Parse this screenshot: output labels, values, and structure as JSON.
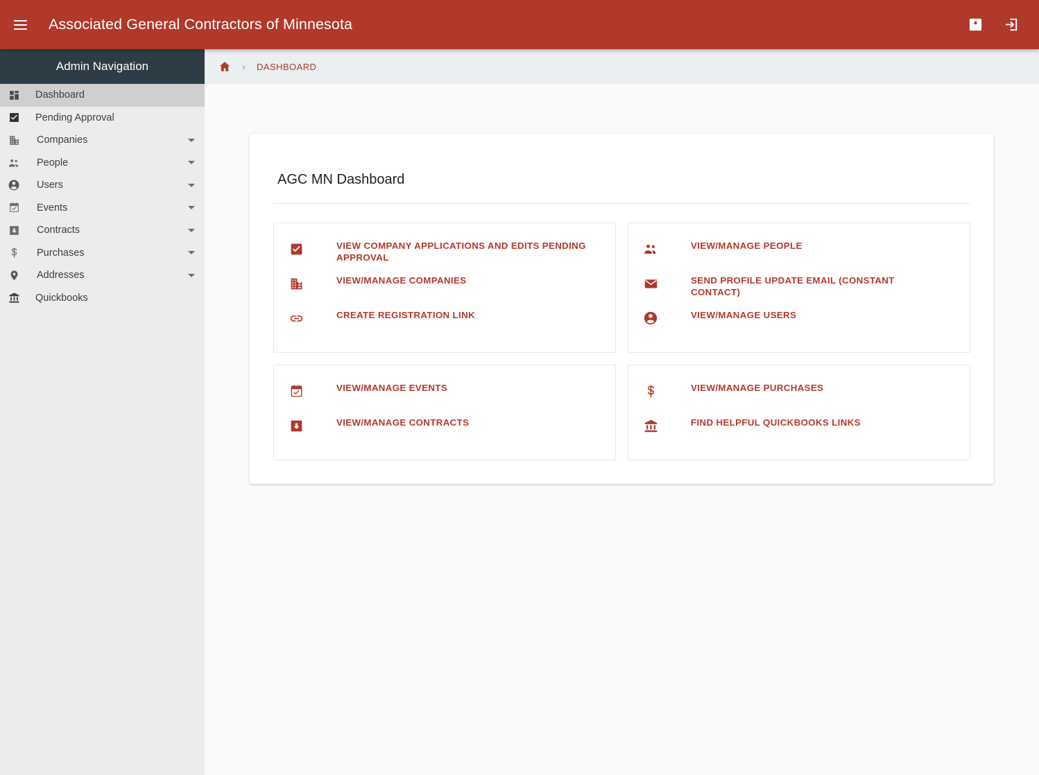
{
  "header": {
    "title": "Associated General Contractors of Minnesota",
    "menu_icon": "hamburger-menu-icon",
    "background_color": "#b0392c",
    "actions": [
      {
        "name": "account-box-icon",
        "label": "Account"
      },
      {
        "name": "logout-icon",
        "label": "Log out"
      }
    ]
  },
  "sidebar": {
    "title": "Admin Navigation",
    "background_color": "#ececec",
    "header_color": "#2e3d45",
    "items": [
      {
        "label": "Dashboard",
        "icon": "dashboard-icon",
        "active": true,
        "expandable": false
      },
      {
        "label": "Pending Approval",
        "icon": "check-box-icon",
        "active": false,
        "expandable": false
      },
      {
        "label": "Companies",
        "icon": "building-icon",
        "active": false,
        "expandable": true
      },
      {
        "label": "People",
        "icon": "people-icon",
        "active": false,
        "expandable": true
      },
      {
        "label": "Users",
        "icon": "account-circle-icon",
        "active": false,
        "expandable": true
      },
      {
        "label": "Events",
        "icon": "event-calendar-icon",
        "active": false,
        "expandable": true
      },
      {
        "label": "Contracts",
        "icon": "contract-box-icon",
        "active": false,
        "expandable": true
      },
      {
        "label": "Purchases",
        "icon": "dollar-sign-icon",
        "active": false,
        "expandable": true
      },
      {
        "label": "Addresses",
        "icon": "location-pin-icon",
        "active": false,
        "expandable": true
      },
      {
        "label": "Quickbooks",
        "icon": "account-balance-icon",
        "active": false,
        "expandable": false
      }
    ]
  },
  "breadcrumb": {
    "home_icon": "home-icon",
    "separator": "›",
    "current": "DASHBOARD",
    "link_color": "#b0392c",
    "separator_color": "#7b9cc4"
  },
  "main": {
    "card_title": "AGC MN Dashboard",
    "link_color": "#b5392c",
    "panels": [
      {
        "name": "companies-panel",
        "links": [
          {
            "label": "VIEW COMPANY APPLICATIONS AND EDITS PENDING APPROVAL",
            "icon": "check-box-icon"
          },
          {
            "label": "VIEW/MANAGE COMPANIES",
            "icon": "building-icon"
          },
          {
            "label": "CREATE REGISTRATION LINK",
            "icon": "link-icon"
          }
        ]
      },
      {
        "name": "people-panel",
        "links": [
          {
            "label": "VIEW/MANAGE PEOPLE",
            "icon": "people-icon"
          },
          {
            "label": "SEND PROFILE UPDATE EMAIL (CONSTANT CONTACT)",
            "icon": "email-icon"
          },
          {
            "label": "VIEW/MANAGE USERS",
            "icon": "account-circle-icon"
          }
        ]
      },
      {
        "name": "events-panel",
        "links": [
          {
            "label": "VIEW/MANAGE EVENTS",
            "icon": "event-calendar-icon"
          },
          {
            "label": "VIEW/MANAGE CONTRACTS",
            "icon": "contract-box-icon"
          }
        ]
      },
      {
        "name": "purchases-panel",
        "links": [
          {
            "label": "VIEW/MANAGE PURCHASES",
            "icon": "dollar-sign-icon"
          },
          {
            "label": "FIND HELPFUL QUICKBOOKS LINKS",
            "icon": "account-balance-icon"
          }
        ]
      }
    ]
  }
}
